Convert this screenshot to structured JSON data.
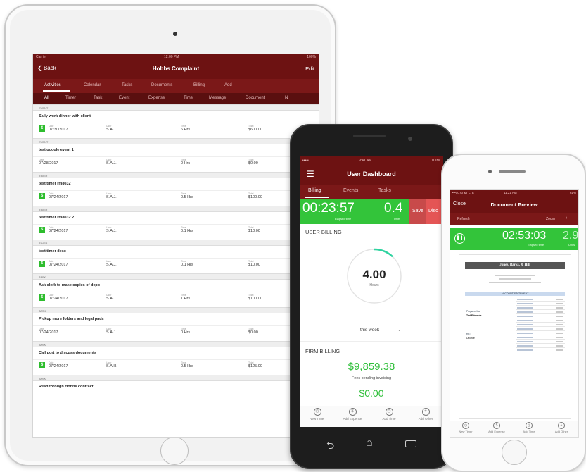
{
  "ipad": {
    "status": {
      "carrier": "Carrier",
      "time": "12:00 PM",
      "battery": "100%"
    },
    "nav": {
      "back": "Back",
      "title": "Hobbs Complaint",
      "edit": "Edit"
    },
    "tabs": [
      "Activities",
      "Calendar",
      "Tasks",
      "Documents",
      "Billing",
      "Add"
    ],
    "filters": [
      "All",
      "Timer",
      "Task",
      "Event",
      "Expense",
      "Time",
      "Message",
      "Document",
      "N"
    ],
    "items": [
      {
        "type": "EVENT",
        "title": "Sally work dinner with client",
        "date": "07/30/2017",
        "user": "S.A.J.",
        "time": "6 Hrs",
        "total": "$600.00",
        "icon": true
      },
      {
        "type": "EVENT",
        "title": "test google event 1",
        "date": "07/28/2017",
        "user": "S.A.J.",
        "time": "0 Hrs",
        "total": "$0.00",
        "icon": false
      },
      {
        "type": "TIMER",
        "title": "test timer rm8032",
        "date": "07/24/2017",
        "user": "S.A.J.",
        "time": "0.5 Hrs",
        "total": "$100.00",
        "icon": true
      },
      {
        "type": "TIMER",
        "title": "test timer rm8032 2",
        "date": "07/24/2017",
        "user": "S.A.J.",
        "time": "0.1 Hrs",
        "total": "$10.00",
        "icon": true
      },
      {
        "type": "TIMER",
        "title": "test timer desc",
        "date": "07/24/2017",
        "user": "S.A.J.",
        "time": "0.1 Hrs",
        "total": "$10.00",
        "icon": true
      },
      {
        "type": "TASK",
        "title": "Ask clerk to make copies of depo",
        "date": "07/24/2017",
        "user": "S.A.J.",
        "time": "1 Hrs",
        "total": "$100.00",
        "icon": true
      },
      {
        "type": "TASK",
        "title": "Pickup more folders and legal pads",
        "date": "07/24/2017",
        "user": "S.A.J.",
        "time": "0 Hrs",
        "total": "$0.00",
        "icon": false
      },
      {
        "type": "TASK",
        "title": "Call port to discuss documents",
        "date": "07/24/2017",
        "user": "S.A.H.",
        "time": "0.5 Hrs",
        "total": "$125.00",
        "icon": true
      },
      {
        "type": "TASK",
        "title": "Read through Hobbs contract",
        "date": "",
        "user": "",
        "time": "",
        "total": "",
        "icon": false
      }
    ],
    "labels": {
      "date": "Date",
      "user": "User",
      "time": "Time",
      "total": "Total"
    }
  },
  "android": {
    "status": {
      "signal": "•••••",
      "time": "9:41 AM",
      "battery": "100%"
    },
    "title": "User Dashboard",
    "tabs": [
      "Billing",
      "Events",
      "Tasks"
    ],
    "timer": {
      "clock": "00:23:57",
      "units": "0.4",
      "elapsed": "Elapsed time",
      "units_label": "Units",
      "save": "Save",
      "discard": "Disc"
    },
    "user_billing": {
      "heading": "USER BILLING",
      "value": "4.00",
      "unit": "Hours",
      "period": "this week",
      "progress": 0.12
    },
    "firm_billing": {
      "heading": "FIRM BILLING",
      "amount": "$9,859.38",
      "caption": "Fees pending invoicing",
      "amount2": "$0.00"
    },
    "bottom": [
      "New Timer",
      "Add Expense",
      "Add Time",
      "Add Other"
    ]
  },
  "iphone": {
    "status": {
      "carrier": "•••oo AT&T LTE",
      "time": "11:21 AM",
      "battery": "61%"
    },
    "close": "Close",
    "title": "Document Preview",
    "refresh": "Refresh",
    "zoom": "Zoom",
    "timer": {
      "clock": "02:53:03",
      "units": "2.9",
      "elapsed": "Elapsed time",
      "units_label": "Units"
    },
    "doc": {
      "firm": "Jones, Barks, & Hill",
      "statement": "ACCOUNT STATEMENT",
      "prepared": "Prepared for",
      "client": "Ted Edwards",
      "re": "RE:",
      "matter": "Divorce"
    },
    "bottom": [
      "New Timer",
      "Add Expense",
      "Add Time",
      "Add Other"
    ]
  },
  "colors": {
    "maroon": "#6d1212",
    "green": "#33c43a",
    "red": "#e45555"
  }
}
